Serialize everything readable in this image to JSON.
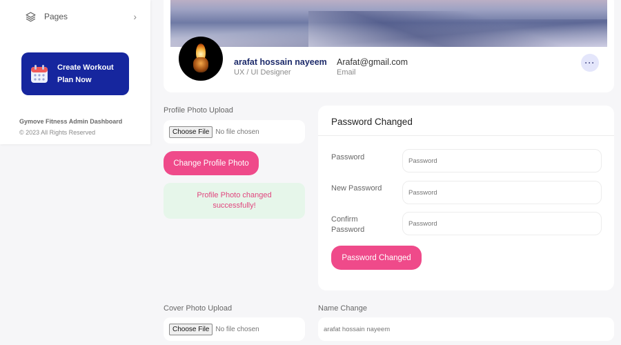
{
  "sidebar": {
    "pages_label": "Pages",
    "workout_line1": "Create Workout",
    "workout_line2": "Plan Now",
    "footer_title": "Gymove Fitness Admin Dashboard",
    "footer_copy": "© 2023 All Rights Reserved"
  },
  "profile": {
    "name": "arafat hossain nayeem",
    "role": "UX / UI Designer",
    "email": "Arafat@gmail.com",
    "email_label": "Email",
    "more_label": "···"
  },
  "photo_upload": {
    "label": "Profile Photo Upload",
    "choose_file": "Choose File",
    "no_file": "No file chosen",
    "button": "Change Profile Photo",
    "success_line1": "Profile Photo changed",
    "success_line2": "successfully!"
  },
  "password": {
    "title": "Password Changed",
    "current_label": "Password",
    "current_placeholder": "Password",
    "new_label": "New Password",
    "new_placeholder": "Password",
    "confirm_label_line1": "Confirm",
    "confirm_label_line2": "Password",
    "confirm_placeholder": "Password",
    "button": "Password Changed"
  },
  "cover_upload": {
    "label": "Cover Photo Upload",
    "choose_file": "Choose File",
    "no_file": "No file chosen"
  },
  "name_change": {
    "label": "Name Change",
    "placeholder": "arafat hossain nayeem"
  },
  "colors": {
    "accent_pink": "#ef4a8a",
    "brand_blue": "#16269e",
    "success_bg": "#e6f6ea"
  }
}
